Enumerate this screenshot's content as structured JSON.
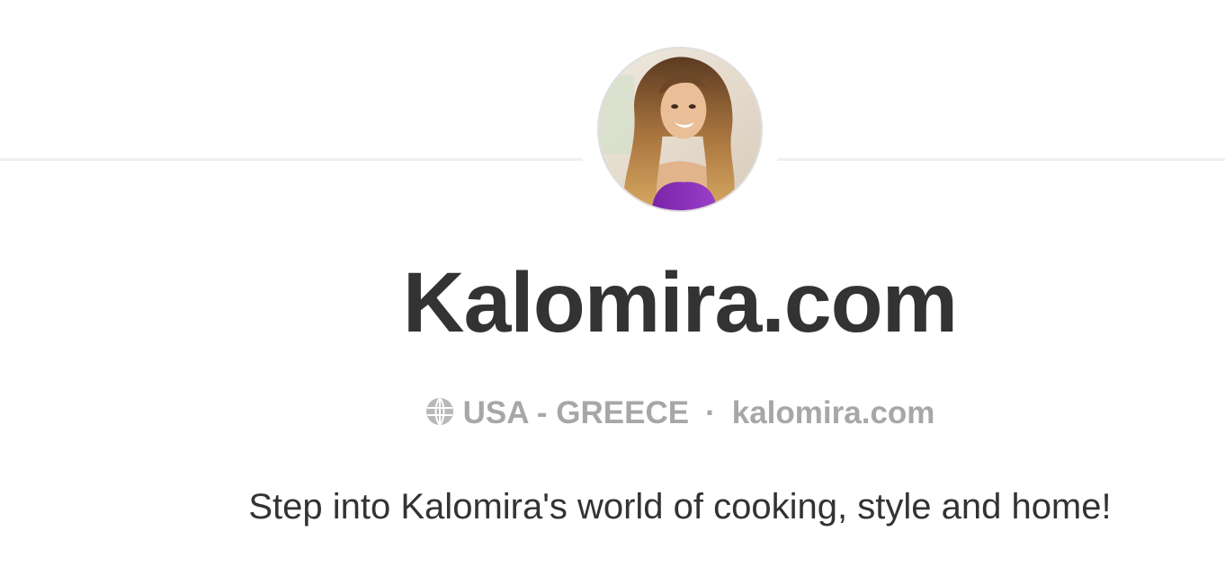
{
  "profile": {
    "avatar_alt": "Kalomira",
    "name": "Kalomira.com",
    "location": "USA - GREECE",
    "separator": "·",
    "website": "kalomira.com",
    "bio": "Step into Kalomira's world of cooking, style and home!"
  },
  "icons": {
    "location": "globe-icon"
  },
  "colors": {
    "text_primary": "#333333",
    "text_secondary": "#a7a7a7",
    "divider": "#efefef",
    "avatar_border": "#dedede"
  }
}
